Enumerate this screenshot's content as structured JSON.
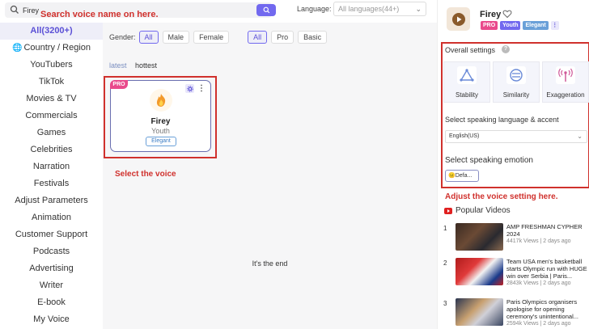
{
  "search": {
    "value": "Firey",
    "annotation": "Search voice name on here."
  },
  "language": {
    "label": "Language:",
    "selected": "All languages(44+)"
  },
  "sidebar": {
    "items": [
      {
        "label": "All(3200+)",
        "active": true
      },
      {
        "label": "Country / Region",
        "icon": "globe-icon"
      },
      {
        "label": "YouTubers"
      },
      {
        "label": "TikTok"
      },
      {
        "label": "Movies & TV"
      },
      {
        "label": "Commercials"
      },
      {
        "label": "Games"
      },
      {
        "label": "Celebrities"
      },
      {
        "label": "Narration"
      },
      {
        "label": "Festivals"
      },
      {
        "label": "Adjust Parameters"
      },
      {
        "label": "Animation"
      },
      {
        "label": "Customer Support"
      },
      {
        "label": "Podcasts"
      },
      {
        "label": "Advertising"
      },
      {
        "label": "Writer"
      },
      {
        "label": "E-book"
      },
      {
        "label": "My Voice"
      }
    ]
  },
  "filters": {
    "gender_label": "Gender:",
    "gender": [
      "All",
      "Male",
      "Female"
    ],
    "tier": [
      "All",
      "Pro",
      "Basic"
    ]
  },
  "sort": {
    "latest": "latest",
    "hottest": "hottest"
  },
  "voice_card": {
    "badge": "PRO",
    "name": "Firey",
    "age": "Youth",
    "tag": "Elegant"
  },
  "annotations": {
    "select_voice": "Select the voice",
    "adjust_setting": "Adjust the voice setting here."
  },
  "end_text": "It's the end",
  "profile": {
    "name": "Firey",
    "tags": [
      "PRO",
      "Youth",
      "Elegant"
    ]
  },
  "settings": {
    "title": "Overall settings",
    "help": "?",
    "cards": [
      {
        "label": "Stability",
        "icon": "stability-icon"
      },
      {
        "label": "Similarity",
        "icon": "similarity-icon"
      },
      {
        "label": "Exaggeration",
        "icon": "exaggeration-icon"
      }
    ],
    "speak_lang_label": "Select speaking language & accent",
    "speak_lang_value": "English(US)",
    "emotion_label": "Select speaking emotion",
    "emotion_value": "Defa..."
  },
  "popular": {
    "title": "Popular Videos",
    "videos": [
      {
        "num": "1",
        "title": "AMP FRESHMAN CYPHER 2024",
        "meta": "4417k Views | 2 days ago"
      },
      {
        "num": "2",
        "title": "Team USA men's basketball starts Olympic run with HUGE win over Serbia | Paris...",
        "meta": "2843k Views | 2 days ago"
      },
      {
        "num": "3",
        "title": "Paris Olympics organisers apologise for opening ceremony's unintentional...",
        "meta": "2594k Views | 2 days ago"
      }
    ]
  },
  "colors": {
    "accent": "#7269ef",
    "annotation": "#d0312d",
    "pro": "#e94a8c"
  }
}
